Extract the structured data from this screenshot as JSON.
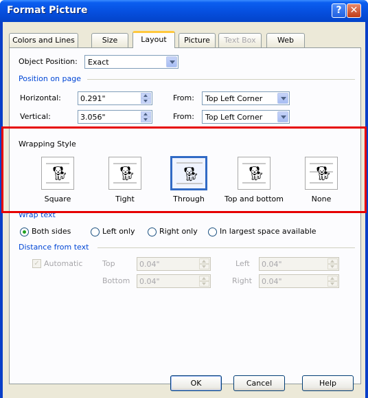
{
  "window": {
    "title": "Format Picture",
    "help_glyph": "?",
    "close_glyph": "✕"
  },
  "tabs": [
    {
      "label": "Colors and Lines",
      "state": "normal"
    },
    {
      "label": "Size",
      "state": "normal"
    },
    {
      "label": "Layout",
      "state": "active"
    },
    {
      "label": "Picture",
      "state": "normal"
    },
    {
      "label": "Text Box",
      "state": "disabled"
    },
    {
      "label": "Web",
      "state": "normal"
    }
  ],
  "object_position": {
    "label": "Object Position:",
    "value": "Exact"
  },
  "position_on_page": {
    "section_label": "Position on page",
    "horizontal": {
      "label": "Horizontal:",
      "value": "0.291\"",
      "from_label": "From:",
      "from_value": "Top Left Corner"
    },
    "vertical": {
      "label": "Vertical:",
      "value": "3.056\"",
      "from_label": "From:",
      "from_value": "Top Left Corner"
    }
  },
  "wrapping_style": {
    "section_label": "Wrapping Style",
    "options": [
      {
        "label": "Square",
        "selected": false
      },
      {
        "label": "Tight",
        "selected": false
      },
      {
        "label": "Through",
        "selected": true
      },
      {
        "label": "Top and bottom",
        "selected": false
      },
      {
        "label": "None",
        "selected": false
      }
    ]
  },
  "wrap_text": {
    "section_label": "Wrap text",
    "options": [
      {
        "label": "Both sides",
        "selected": true
      },
      {
        "label": "Left only",
        "selected": false
      },
      {
        "label": "Right only",
        "selected": false
      },
      {
        "label": "In largest space available",
        "selected": false
      }
    ]
  },
  "distance_from_text": {
    "section_label": "Distance from text",
    "automatic_label": "Automatic",
    "automatic_checked": true,
    "top": {
      "label": "Top",
      "value": "0.04\""
    },
    "bottom": {
      "label": "Bottom",
      "value": "0.04\""
    },
    "left": {
      "label": "Left",
      "value": "0.04\""
    },
    "right": {
      "label": "Right",
      "value": "0.04\""
    }
  },
  "buttons": {
    "ok": "OK",
    "cancel": "Cancel",
    "help": "Help"
  },
  "colors": {
    "title_bar": "#0650e0",
    "dialog_bg": "#ece9d8",
    "section_text": "#0046d5",
    "highlight_box": "#e60000",
    "selected_border": "#316ac5"
  }
}
